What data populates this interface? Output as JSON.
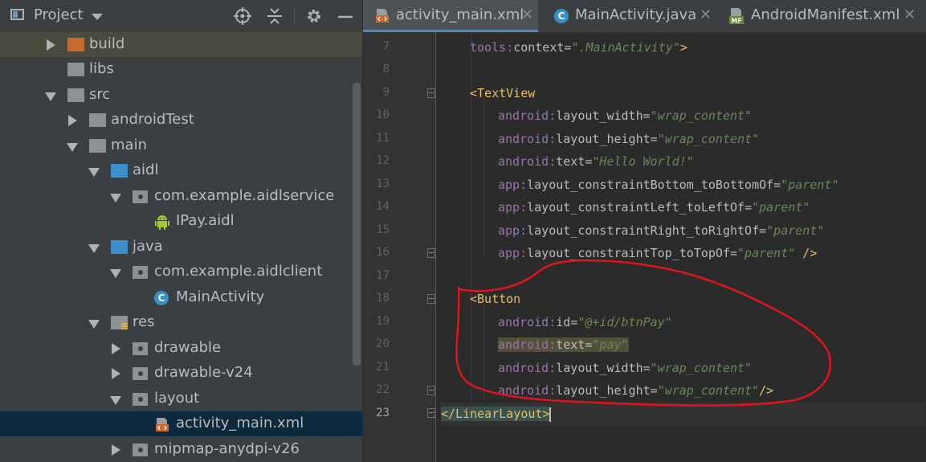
{
  "project_panel": {
    "title": "Project",
    "icons": [
      "project-view-icon",
      "dropdown-caret-icon",
      "locate-icon",
      "collapse-all-icon",
      "gear-icon",
      "minimize-icon"
    ],
    "tree": [
      {
        "label": "build",
        "icon": "folder-icon",
        "expanded": false
      },
      {
        "label": "libs",
        "icon": "folder-icon"
      },
      {
        "label": "src",
        "icon": "folder-icon",
        "expanded": true
      },
      {
        "label": "androidTest",
        "icon": "folder-icon",
        "expanded": false
      },
      {
        "label": "main",
        "icon": "folder-icon",
        "expanded": true
      },
      {
        "label": "aidl",
        "icon": "folder-icon",
        "expanded": true
      },
      {
        "label": "com.example.aidlservice",
        "icon": "package-icon",
        "expanded": true
      },
      {
        "label": "IPay.aidl",
        "icon": "android-icon"
      },
      {
        "label": "java",
        "icon": "folder-icon",
        "expanded": true
      },
      {
        "label": "com.example.aidlclient",
        "icon": "package-icon",
        "expanded": true
      },
      {
        "label": "MainActivity",
        "icon": "class-icon"
      },
      {
        "label": "res",
        "icon": "resource-folder-icon",
        "expanded": true
      },
      {
        "label": "drawable",
        "icon": "package-icon",
        "expanded": false
      },
      {
        "label": "drawable-v24",
        "icon": "package-icon",
        "expanded": false
      },
      {
        "label": "layout",
        "icon": "package-icon",
        "expanded": true
      },
      {
        "label": "activity_main.xml",
        "icon": "layout-xml-icon",
        "selected": true
      },
      {
        "label": "mipmap-anydpi-v26",
        "icon": "package-icon",
        "expanded": false
      }
    ]
  },
  "editor": {
    "tabs": [
      {
        "label": "activity_main.xml",
        "icon": "layout-xml-icon",
        "close": "✕",
        "active": true
      },
      {
        "label": "MainActivity.java",
        "icon": "class-icon",
        "close": "✕",
        "active": false
      },
      {
        "label": "AndroidManifest.xml",
        "icon": "manifest-icon",
        "close": "✕",
        "active": false
      }
    ],
    "class_icon_letter": "C",
    "manifest_icon_letters": "MF",
    "lines": [
      {
        "num": "7",
        "text": "tools:context=\".MainActivity\">"
      },
      {
        "num": "8",
        "text": ""
      },
      {
        "num": "9",
        "text": "<TextView"
      },
      {
        "num": "10",
        "text": "android:layout_width=\"wrap_content\""
      },
      {
        "num": "11",
        "text": "android:layout_height=\"wrap_content\""
      },
      {
        "num": "12",
        "text": "android:text=\"Hello World!\""
      },
      {
        "num": "13",
        "text": "app:layout_constraintBottom_toBottomOf=\"parent\""
      },
      {
        "num": "14",
        "text": "app:layout_constraintLeft_toLeftOf=\"parent\""
      },
      {
        "num": "15",
        "text": "app:layout_constraintRight_toRightOf=\"parent\""
      },
      {
        "num": "16",
        "text": "app:layout_constraintTop_toTopOf=\"parent\" />"
      },
      {
        "num": "17",
        "text": ""
      },
      {
        "num": "18",
        "text": "<Button"
      },
      {
        "num": "19",
        "text": "android:id=\"@+id/btnPay\""
      },
      {
        "num": "20",
        "text": "android:text=\"pay\""
      },
      {
        "num": "21",
        "text": "android:layout_width=\"wrap_content\""
      },
      {
        "num": "22",
        "text": "android:layout_height=\"wrap_content\"/>"
      },
      {
        "num": "23",
        "text": "</LinearLayout>",
        "current": true
      }
    ],
    "code": {
      "l7": {
        "ns": "tools",
        "colon": ":",
        "attr": "context",
        "eq": "=",
        "val": "\".MainActivity\"",
        "end": ">"
      },
      "l9": {
        "tag": "<TextView"
      },
      "l10": {
        "ns": "android",
        "colon": ":",
        "attr": "layout_width",
        "eq": "=",
        "val": "\"wrap_content\""
      },
      "l11": {
        "ns": "android",
        "colon": ":",
        "attr": "layout_height",
        "eq": "=",
        "val": "\"wrap_content\""
      },
      "l12": {
        "ns": "android",
        "colon": ":",
        "attr": "text",
        "eq": "=",
        "val": "\"Hello World!\""
      },
      "l13": {
        "ns": "app",
        "colon": ":",
        "attr": "layout_constraintBottom_toBottomOf",
        "eq": "=",
        "val": "\"parent\""
      },
      "l14": {
        "ns": "app",
        "colon": ":",
        "attr": "layout_constraintLeft_toLeftOf",
        "eq": "=",
        "val": "\"parent\""
      },
      "l15": {
        "ns": "app",
        "colon": ":",
        "attr": "layout_constraintRight_toRightOf",
        "eq": "=",
        "val": "\"parent\""
      },
      "l16": {
        "ns": "app",
        "colon": ":",
        "attr": "layout_constraintTop_toTopOf",
        "eq": "=",
        "val": "\"parent\"",
        "end": " />"
      },
      "l18": {
        "tag": "<Button"
      },
      "l19": {
        "ns": "android",
        "colon": ":",
        "attr": "id",
        "eq": "=",
        "val": "\"@+id/btnPay\""
      },
      "l20": {
        "ns": "android",
        "colon": ":",
        "attr": "text",
        "eq": "=",
        "val": "\"pay\""
      },
      "l21": {
        "ns": "android",
        "colon": ":",
        "attr": "layout_width",
        "eq": "=",
        "val": "\"wrap_content\""
      },
      "l22": {
        "ns": "android",
        "colon": ":",
        "attr": "layout_height",
        "eq": "=",
        "val": "\"wrap_content\"",
        "end": "/>"
      },
      "l23": {
        "tag": "</LinearLayout>"
      }
    }
  },
  "colors": {
    "annotation_red": "#e0141e",
    "tag": "#e8bf6a",
    "namespace": "#9876aa",
    "value": "#6a8759",
    "selection_row": "#0d293e"
  }
}
